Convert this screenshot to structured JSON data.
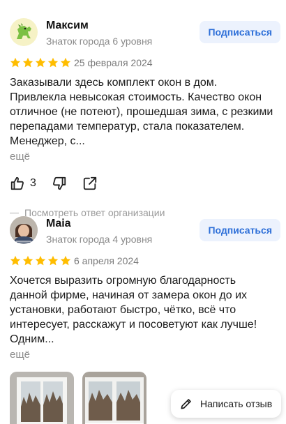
{
  "reviews": [
    {
      "author": "Максим",
      "level": "Знаток города 6 уровня",
      "subscribe_label": "Подписаться",
      "rating": 5,
      "date": "25 февраля 2024",
      "text": "Заказывали здесь комплект окон в дом. Привлекла невысокая стоимость. Качество окон отличное (не потеют), прошедшая зима, с резкими перепадами температур, стала показателем. Менеджер, с...",
      "more_label": "ещё",
      "likes": "3",
      "org_reply_label": "Посмотреть ответ организации",
      "avatar_icon": "dinosaur-avatar-icon"
    },
    {
      "author": "Maia",
      "level": "Знаток города 4 уровня",
      "subscribe_label": "Подписаться",
      "rating": 5,
      "date": "6 апреля 2024",
      "text": "Хочется выразить огромную благодарность данной фирме, начиная от замера окон до их установки, работают быстро, чётко, всё что интересует, расскажут и посоветуют как лучше! Одним...",
      "more_label": "ещё",
      "photos": [
        "window-photo-1",
        "window-photo-2"
      ]
    }
  ],
  "write_review_label": "Написать отзыв",
  "colors": {
    "star": "#ffbd00",
    "accent": "#2d6fd8",
    "subscribe_bg": "#ecf2fd"
  }
}
